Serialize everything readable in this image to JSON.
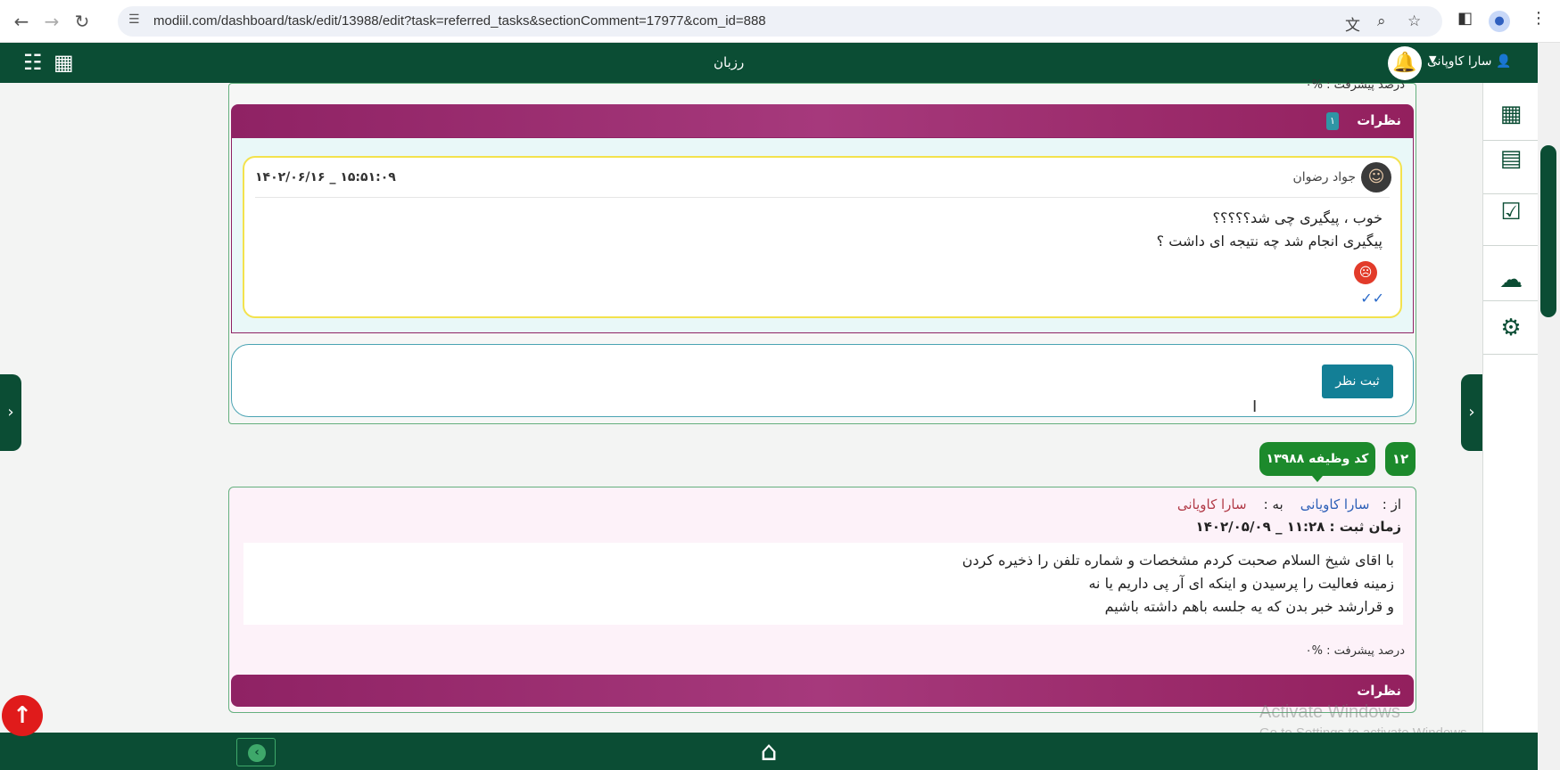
{
  "browser": {
    "url": "modiil.com/dashboard/task/edit/13988/edit?task=referred_tasks&sectionComment=17977&com_id=888"
  },
  "appbar": {
    "title": "رزبان",
    "user_name": "سارا کاوپانی"
  },
  "top_section": {
    "progress_partial": "درصد پیشرفت : %۰",
    "comments_header": "نظرات",
    "comments_count": "۱",
    "comment": {
      "author": "جواد رضوان",
      "timestamp": "۱۴۰۲/۰۶/۱۶ _ ۱۵:۵۱:۰۹",
      "lines": [
        "خوب ، پیگیری چی شد؟؟؟؟؟",
        "پیگیری انجام شد چه نتیجه ای داشت ؟"
      ]
    },
    "submit_label": "ثبت نظر"
  },
  "task": {
    "index": "۱۲",
    "code_label": "کد وظیفه ۱۳۹۸۸",
    "from_label": "از :",
    "from_name": "سارا کاویانی",
    "to_label": "به :",
    "to_name": "سارا کاویانی",
    "registered_at": "زمان ثبت : ۱۱:۲۸ _ ۱۴۰۲/۰۵/۰۹",
    "description": [
      "با اقای شیخ السلام صحبت کردم مشخصات و شماره تلفن را ذخیره کردن",
      "زمینه فعالیت را پرسیدن و اینکه ای آر پی داریم یا نه",
      "و قرارشد خبر بدن که یه جلسه باهم داشته باشیم"
    ],
    "progress": "درصد پیشرفت : %۰",
    "comments_header": "نظرات"
  },
  "watermark": {
    "line1": "Activate Windows",
    "line2": "Go to Settings to activate Windows."
  }
}
